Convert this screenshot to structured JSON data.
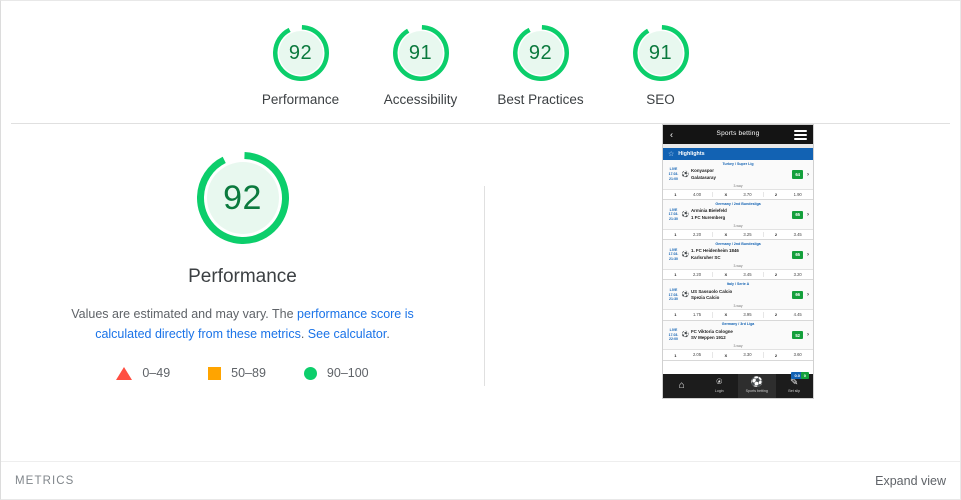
{
  "scores": [
    {
      "value": "92",
      "label": "Performance",
      "percent": 92,
      "color": "#0cce6b"
    },
    {
      "value": "91",
      "label": "Accessibility",
      "percent": 91,
      "color": "#0cce6b"
    },
    {
      "value": "92",
      "label": "Best Practices",
      "percent": 92,
      "color": "#0cce6b"
    },
    {
      "value": "91",
      "label": "SEO",
      "percent": 91,
      "color": "#0cce6b"
    }
  ],
  "main": {
    "gauge_value": "92",
    "gauge_percent": 92,
    "title": "Performance",
    "desc_part1": "Values are estimated and may vary. The ",
    "link1": "performance score is calculated directly from these metrics",
    "desc_part2": ". ",
    "link2": "See calculator",
    "desc_part3": "."
  },
  "legend": [
    {
      "shape": "triangle-icon",
      "label": "0–49",
      "color": "#ff4e42"
    },
    {
      "shape": "square-icon",
      "label": "50–89",
      "color": "#ffa400"
    },
    {
      "shape": "circle-icon",
      "label": "90–100",
      "color": "#0cce6b"
    }
  ],
  "footer": {
    "metrics_label": "METRICS",
    "expand_view": "Expand view"
  },
  "phone": {
    "header_title": "Sports betting",
    "back_icon": "‹",
    "highlights_label": "Highlights",
    "three_way_label": "3-way",
    "matches": [
      {
        "league": "Turkey / Super Lig",
        "live": "LIVE",
        "date": "17.03.",
        "time": "21:00",
        "team_home": "Konyaspor",
        "team_away": "Galatasaray",
        "badge": "64",
        "odds": [
          {
            "key": "1",
            "value": "4.00"
          },
          {
            "key": "X",
            "value": "3.70"
          },
          {
            "key": "2",
            "value": "1.90"
          }
        ]
      },
      {
        "league": "Germany / 2nd Bundesliga",
        "live": "LIVE",
        "date": "17.03.",
        "time": "21:30",
        "team_home": "Arminia Bielefeld",
        "team_away": "1 FC Nuremberg",
        "badge": "65",
        "odds": [
          {
            "key": "1",
            "value": "2.20"
          },
          {
            "key": "X",
            "value": "3.25"
          },
          {
            "key": "2",
            "value": "3.45"
          }
        ]
      },
      {
        "league": "Germany / 2nd Bundesliga",
        "live": "LIVE",
        "date": "17.03.",
        "time": "21:30",
        "team_home": "1. FC Heidenheim 1846",
        "team_away": "Karlsruher SC",
        "badge": "65",
        "odds": [
          {
            "key": "1",
            "value": "2.20"
          },
          {
            "key": "X",
            "value": "3.45"
          },
          {
            "key": "2",
            "value": "3.20"
          }
        ]
      },
      {
        "league": "Italy / Serie A",
        "live": "LIVE",
        "date": "17.03.",
        "time": "21:30",
        "team_home": "US Sassuolo Calcio",
        "team_away": "Spezia Calcio",
        "badge": "66",
        "odds": [
          {
            "key": "1",
            "value": "1.75"
          },
          {
            "key": "X",
            "value": "3.95"
          },
          {
            "key": "2",
            "value": "4.45"
          }
        ]
      },
      {
        "league": "Germany / 3rd Liga",
        "live": "LIVE",
        "date": "17.03.",
        "time": "22:00",
        "team_home": "FC Viktoria Cologne",
        "team_away": "SV Meppen 1912",
        "badge": "52",
        "odds": [
          {
            "key": "1",
            "value": "2.05"
          },
          {
            "key": "X",
            "value": "3.30"
          },
          {
            "key": "2",
            "value": "3.60"
          }
        ]
      }
    ],
    "nav": [
      {
        "icon": "⌂",
        "label": "",
        "name": "home"
      },
      {
        "icon": "⍟",
        "label": "Login",
        "name": "login"
      },
      {
        "icon": "⚽",
        "label": "Sports betting",
        "name": "sports-betting"
      },
      {
        "icon": "✎",
        "label": "Bet slip",
        "name": "bet-slip"
      }
    ],
    "nav_badge_blue": "0.0",
    "nav_badge_green": "0"
  }
}
